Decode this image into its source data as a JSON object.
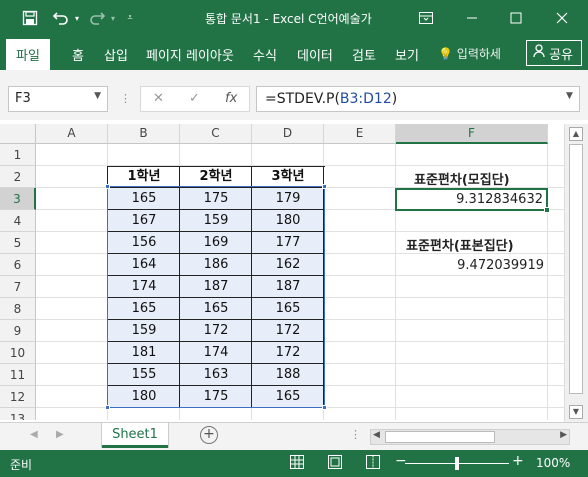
{
  "titlebar": {
    "title": "통합 문서1  -  Excel   C언어예술가",
    "save_icon": "save-icon",
    "undo_icon": "undo-icon",
    "redo_icon": "redo-icon"
  },
  "ribbon": {
    "tabs": [
      "파일",
      "홈",
      "삽입",
      "페이지 레이아웃",
      "수식",
      "데이터",
      "검토",
      "보기"
    ],
    "tellme": "입력하세",
    "share": "공유"
  },
  "formula_bar": {
    "name_box": "F3",
    "cancel": "✕",
    "enter": "✓",
    "fx": "fx",
    "formula_prefix": "=STDEV.P(",
    "formula_ref": "B3:D12",
    "formula_suffix": ")"
  },
  "grid": {
    "columns": [
      "A",
      "B",
      "C",
      "D",
      "E",
      "F"
    ],
    "rows": [
      "1",
      "2",
      "3",
      "4",
      "5",
      "6",
      "7",
      "8",
      "9",
      "10",
      "11",
      "12",
      "13"
    ],
    "table_headers": [
      "1학년",
      "2학년",
      "3학년"
    ],
    "table_rows": [
      [
        "165",
        "175",
        "179"
      ],
      [
        "167",
        "159",
        "180"
      ],
      [
        "156",
        "169",
        "177"
      ],
      [
        "164",
        "186",
        "162"
      ],
      [
        "174",
        "187",
        "187"
      ],
      [
        "165",
        "165",
        "165"
      ],
      [
        "159",
        "172",
        "172"
      ],
      [
        "181",
        "174",
        "172"
      ],
      [
        "155",
        "163",
        "188"
      ],
      [
        "180",
        "175",
        "165"
      ]
    ],
    "pop_label": "표준편차(모집단)",
    "pop_value": "9.312834632",
    "sample_label": "표준편차(표본집단)",
    "sample_value": "9.472039919"
  },
  "sheets": {
    "active": "Sheet1"
  },
  "status": {
    "ready": "준비",
    "zoom": "100%"
  }
}
